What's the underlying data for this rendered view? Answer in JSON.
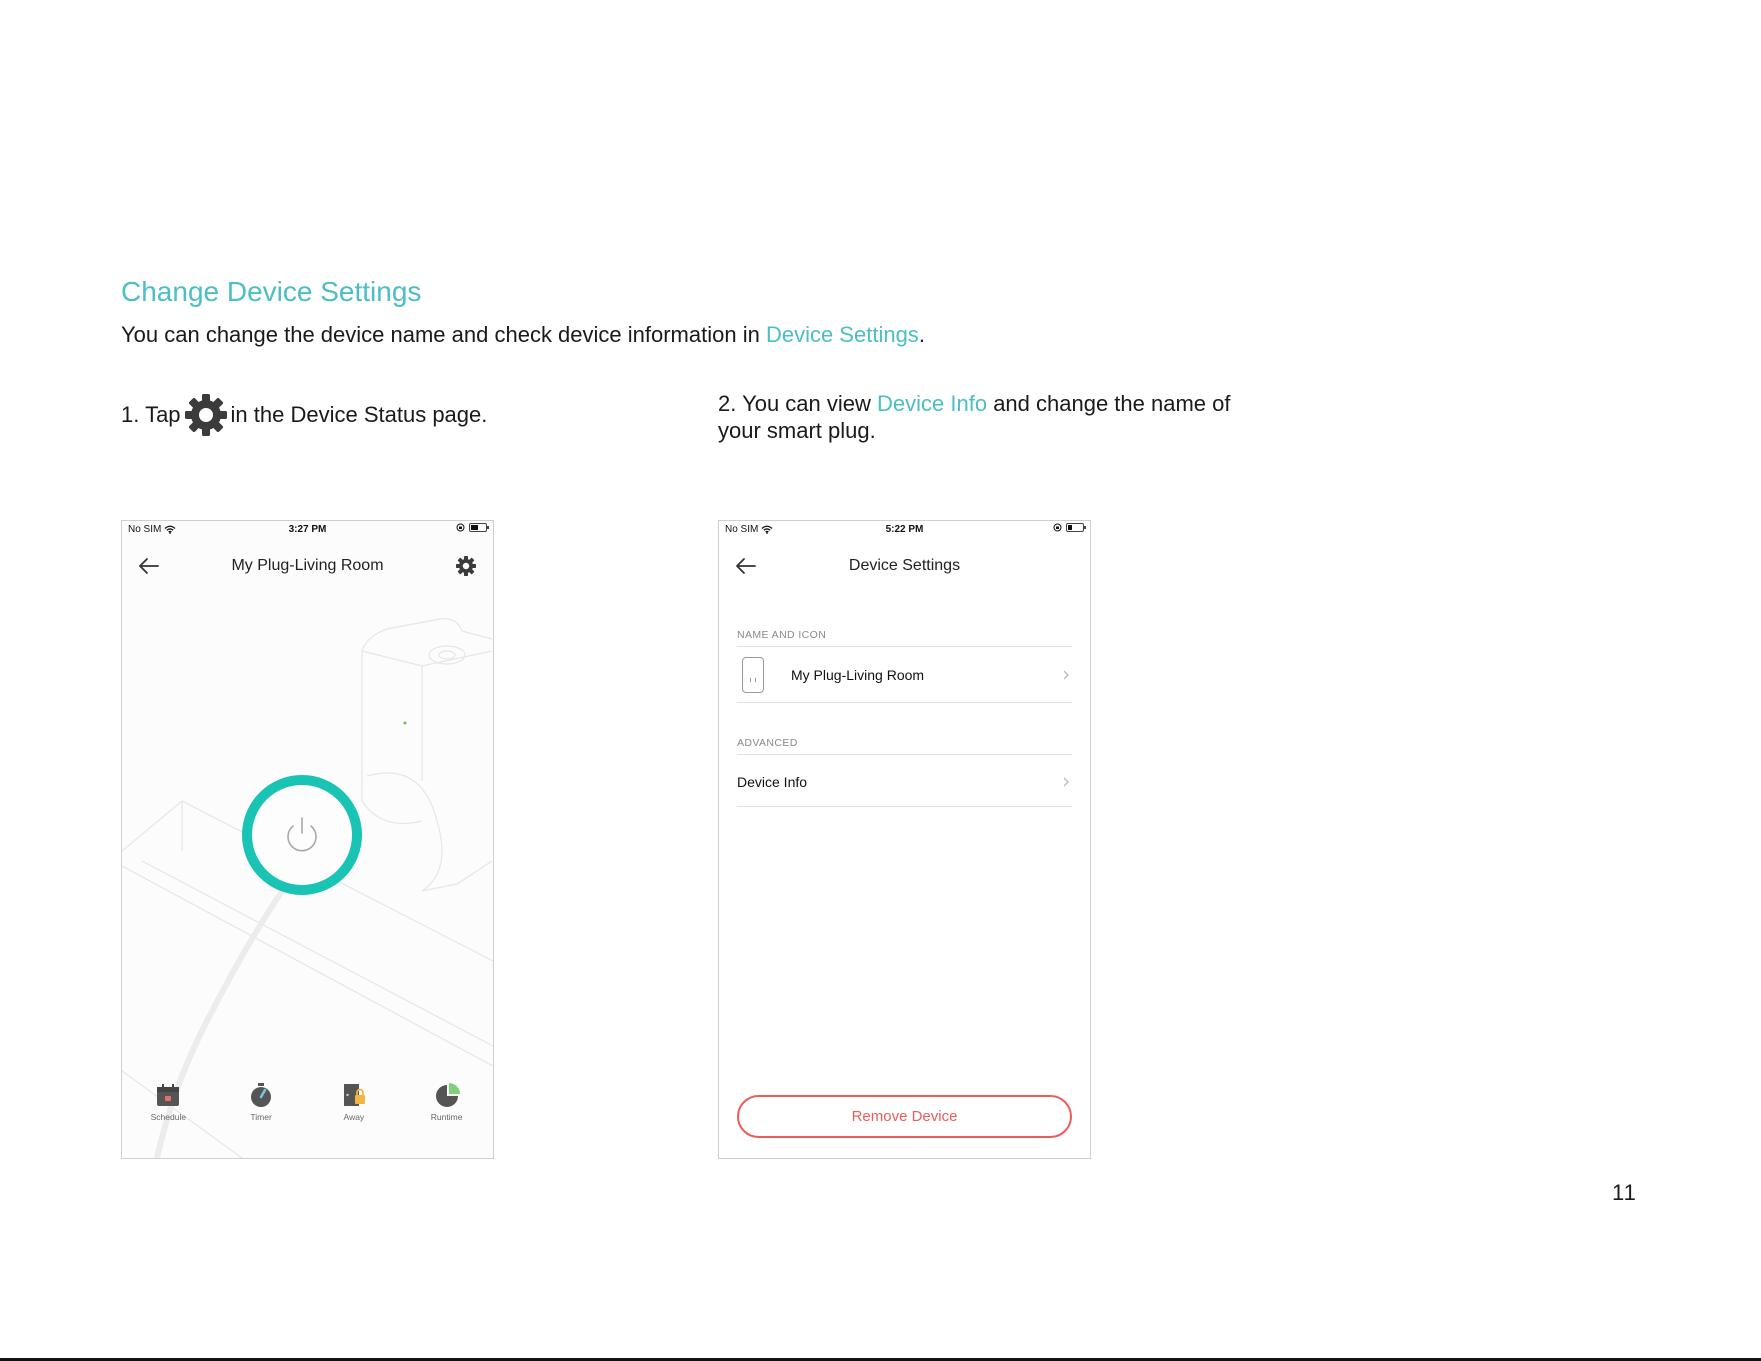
{
  "page": {
    "title": "Change Device Settings",
    "intro_prefix": "You can change the device name and check device information in ",
    "intro_link": "Device Settings",
    "intro_suffix": ".",
    "step1_prefix": "1. Tap",
    "step1_suffix": "in the Device Status page.",
    "step1_icon": "gear-icon",
    "step2_prefix": "2. You can view ",
    "step2_link": "Device Info",
    "step2_suffix": " and change the name of your smart plug.",
    "page_number": "11",
    "accent_color": "#4bbfc4"
  },
  "phone1": {
    "status": {
      "carrier": "No SIM",
      "time": "3:27 PM"
    },
    "nav_title": "My Plug-Living Room",
    "power_ring_color": "#19c4b4",
    "tabs": [
      {
        "label": "Schedule",
        "icon": "calendar-icon"
      },
      {
        "label": "Timer",
        "icon": "timer-icon"
      },
      {
        "label": "Away",
        "icon": "away-icon"
      },
      {
        "label": "Runtime",
        "icon": "pie-chart-icon"
      }
    ]
  },
  "phone2": {
    "status": {
      "carrier": "No SIM",
      "time": "5:22 PM"
    },
    "nav_title": "Device Settings",
    "section_name_icon": "NAME AND ICON",
    "device_name": "My Plug-Living Room",
    "section_advanced": "ADVANCED",
    "device_info": "Device Info",
    "remove_button": "Remove Device",
    "danger_color": "#ef5b5b"
  }
}
